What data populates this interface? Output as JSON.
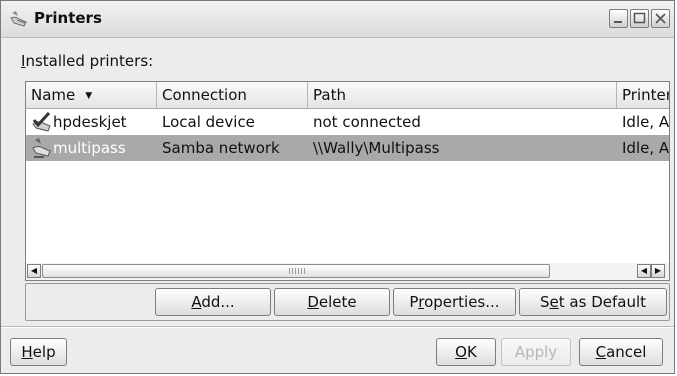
{
  "window": {
    "title": "Printers"
  },
  "installed_label": {
    "prefix": "I",
    "rest": "nstalled printers:"
  },
  "table": {
    "columns": [
      "Name",
      "Connection",
      "Path",
      "Printer"
    ],
    "rows": [
      {
        "name": "hpdeskjet",
        "connection": "Local device",
        "path": "not connected",
        "status": "Idle, Ac",
        "selected": false,
        "icon": "printer-checkmark-icon"
      },
      {
        "name": "multipass",
        "connection": "Samba network",
        "path": "\\\\Wally\\Multipass",
        "status": "Idle, Ac",
        "selected": true,
        "icon": "network-printer-icon"
      }
    ]
  },
  "buttons": {
    "add": {
      "mnemonic": "A",
      "rest": "dd..."
    },
    "delete": {
      "mnemonic": "D",
      "rest": "elete"
    },
    "properties": {
      "pre": "P",
      "mnemonic": "r",
      "rest": "operties..."
    },
    "default": {
      "pre": "S",
      "mnemonic": "e",
      "rest": "t as Default"
    },
    "help": {
      "mnemonic": "H",
      "rest": "elp"
    },
    "ok": {
      "mnemonic": "O",
      "rest": "K"
    },
    "apply": {
      "label": "Apply"
    },
    "cancel": {
      "mnemonic": "C",
      "rest": "ancel"
    }
  }
}
